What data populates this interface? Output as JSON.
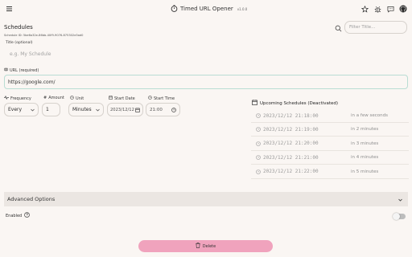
{
  "header": {
    "title": "Timed URL Opener",
    "version": "v1.0.0",
    "icons": [
      "timer-icon",
      "star-icon",
      "bug-icon",
      "chat-icon",
      "github-icon"
    ]
  },
  "schedules": {
    "title": "Schedules",
    "id_label": "Schedule ID: 5be6a32e-86bb-40f9-9076-875302e3ad0",
    "search_placeholder": "Filter Title..."
  },
  "form": {
    "title_label": "Title (optional)",
    "title_placeholder": "e.g. My Schedule",
    "url_label": "URL (required)",
    "url_value": "https://google.com/",
    "frequency_label": "Frequency",
    "frequency_value": "Every",
    "amount_label": "Amount",
    "amount_value": "1",
    "unit_label": "Unit",
    "unit_value": "Minutes",
    "start_date_label": "Start Date",
    "start_date_value": "2023/12/12",
    "start_time_label": "Start Time",
    "start_time_value": "21:00"
  },
  "upcoming": {
    "title": "Upcoming Schedules (Deactivated)",
    "rows": [
      {
        "time": "2023/12/12 21:18:00",
        "relative": "in a few seconds"
      },
      {
        "time": "2023/12/12 21:19:00",
        "relative": "in 2 minutes"
      },
      {
        "time": "2023/12/12 21:20:00",
        "relative": "in 3 minutes"
      },
      {
        "time": "2023/12/12 21:21:00",
        "relative": "in 4 minutes"
      },
      {
        "time": "2023/12/12 21:22:00",
        "relative": "in 5 minutes"
      }
    ]
  },
  "advanced": {
    "label": "Advanced Options"
  },
  "enabled": {
    "label": "Enabled",
    "value": false
  },
  "actions": {
    "delete_label": "Delete"
  },
  "colors": {
    "background": "#faf6f3",
    "accent_pink": "#f0a3bd",
    "url_border": "#b9ddd3",
    "advanced_bg": "#ebe6e2"
  }
}
